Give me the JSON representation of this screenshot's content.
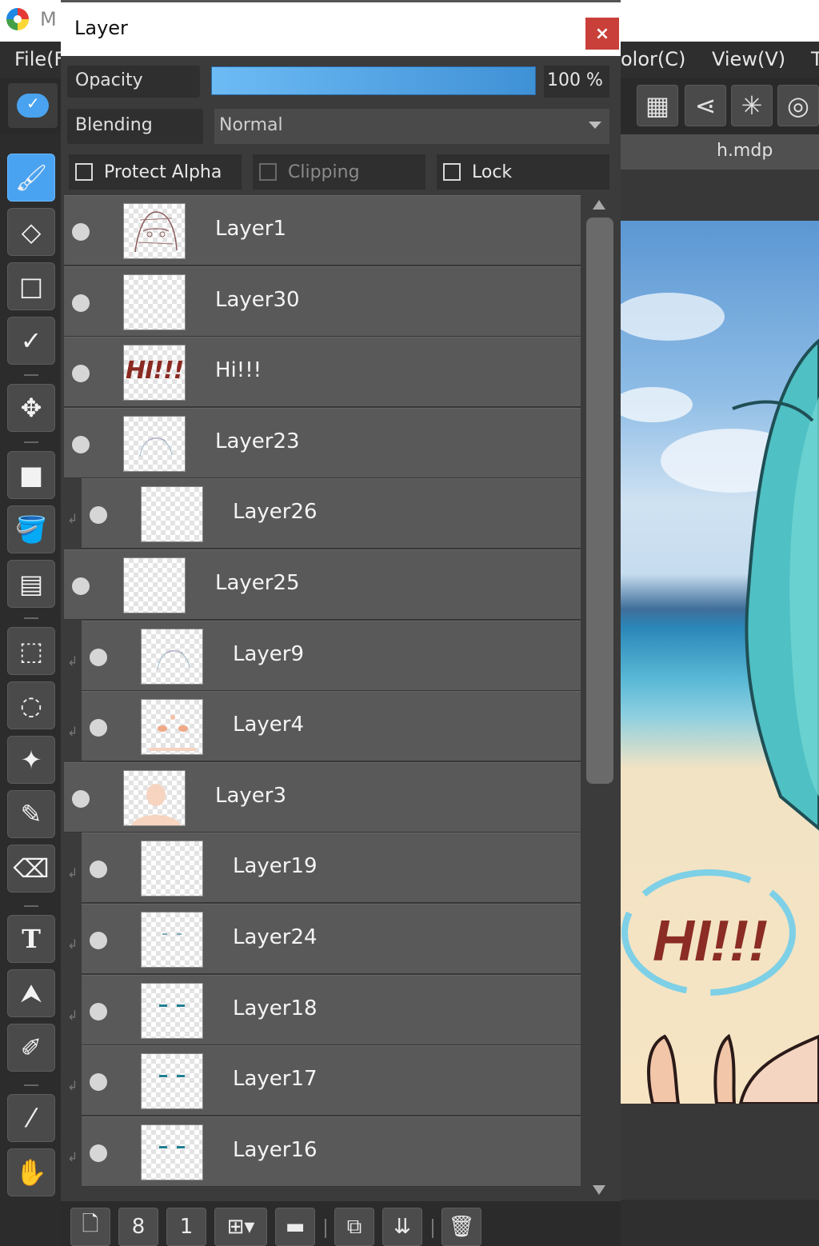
{
  "app": {
    "title_fragment": "M",
    "menu": [
      "File(F",
      "olor(C)",
      "View(V)",
      "T"
    ],
    "document_tab": "h.mdp"
  },
  "canvas": {
    "sign_text": "HI!!!"
  },
  "layer_window": {
    "title": "Layer",
    "close_label": "×",
    "opacity_label": "Opacity",
    "opacity_value": 100,
    "opacity_text": "100 %",
    "blending_label": "Blending",
    "blending_value": "Normal",
    "protect_alpha_label": "Protect Alpha",
    "protect_alpha_checked": false,
    "clipping_label": "Clipping",
    "clipping_enabled": false,
    "lock_label": "Lock",
    "lock_checked": false,
    "layers": [
      {
        "name": "Layer1",
        "clipped": false,
        "visible": true,
        "thumb": "sketch"
      },
      {
        "name": "Layer30",
        "clipped": false,
        "visible": true,
        "thumb": "empty"
      },
      {
        "name": "Hi!!!",
        "clipped": false,
        "visible": true,
        "thumb": "text",
        "thumb_text": "HI!!!"
      },
      {
        "name": "Layer23",
        "clipped": false,
        "visible": true,
        "thumb": "faint"
      },
      {
        "name": "Layer26",
        "clipped": true,
        "visible": true,
        "thumb": "empty"
      },
      {
        "name": "Layer25",
        "clipped": false,
        "visible": true,
        "thumb": "empty"
      },
      {
        "name": "Layer9",
        "clipped": true,
        "visible": true,
        "thumb": "faint"
      },
      {
        "name": "Layer4",
        "clipped": true,
        "visible": true,
        "thumb": "blush"
      },
      {
        "name": "Layer3",
        "clipped": false,
        "visible": true,
        "thumb": "skin"
      },
      {
        "name": "Layer19",
        "clipped": true,
        "visible": true,
        "thumb": "empty"
      },
      {
        "name": "Layer24",
        "clipped": true,
        "visible": true,
        "thumb": "eyes-faint"
      },
      {
        "name": "Layer18",
        "clipped": true,
        "visible": true,
        "thumb": "eyes"
      },
      {
        "name": "Layer17",
        "clipped": true,
        "visible": true,
        "thumb": "eyes"
      },
      {
        "name": "Layer16",
        "clipped": true,
        "visible": true,
        "thumb": "eyes"
      }
    ],
    "bottom_icons": [
      "new-layer-icon",
      "new-8bit-layer-icon",
      "new-1bit-layer-icon",
      "add-layer-menu-icon",
      "folder-icon",
      "duplicate-layer-icon",
      "merge-down-icon",
      "delete-layer-icon"
    ],
    "bottom_glyphs": [
      "🗋",
      "8",
      "1",
      "⊞▾",
      "▬",
      "⧉",
      "⇊",
      "🗑"
    ]
  },
  "toolbox": {
    "tools": [
      {
        "name": "brush-tool",
        "glyph": "🖌",
        "active": true
      },
      {
        "name": "eraser-tool",
        "glyph": "◇",
        "active": false
      },
      {
        "name": "shape-tool",
        "glyph": "□",
        "active": false
      },
      {
        "name": "correction-tool",
        "glyph": "✓",
        "active": false
      },
      {
        "name": "move-tool",
        "glyph": "✥",
        "active": false
      },
      {
        "name": "fill-rect-tool",
        "glyph": "■",
        "active": false
      },
      {
        "name": "bucket-tool",
        "glyph": "🪣",
        "active": false
      },
      {
        "name": "gradient-tool",
        "glyph": "▤",
        "active": false
      },
      {
        "name": "select-rect-tool",
        "glyph": "⬚",
        "active": false
      },
      {
        "name": "lasso-tool",
        "glyph": "◌",
        "active": false
      },
      {
        "name": "magic-wand-tool",
        "glyph": "✦",
        "active": false
      },
      {
        "name": "select-pen-tool",
        "glyph": "✎",
        "active": false
      },
      {
        "name": "select-eraser-tool",
        "glyph": "⌫",
        "active": false
      },
      {
        "name": "text-tool",
        "glyph": "T",
        "active": false
      },
      {
        "name": "operation-tool",
        "glyph": "⮝",
        "active": false
      },
      {
        "name": "divide-tool",
        "glyph": "✐",
        "active": false
      },
      {
        "name": "eyedropper-tool",
        "glyph": "⁄",
        "active": false
      },
      {
        "name": "hand-tool",
        "glyph": "✋",
        "active": false
      }
    ]
  },
  "top_toolbar": {
    "icons": [
      "grid-icon",
      "perspective-icon",
      "radial-icon",
      "concentric-icon"
    ],
    "glyphs": [
      "▦",
      "⋖",
      "✳",
      "◎"
    ]
  },
  "colors": {
    "accent": "#4aa3f0",
    "close": "#c9403a",
    "row": "#595959",
    "panel": "#3b3b3b"
  }
}
